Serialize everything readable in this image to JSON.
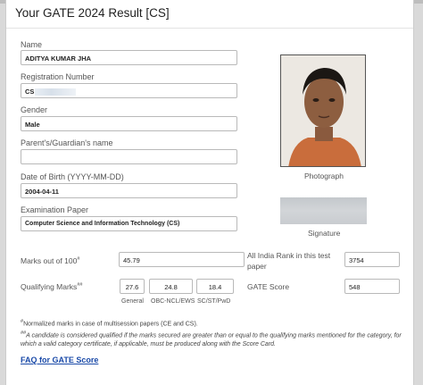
{
  "modal": {
    "title": "Your GATE 2024 Result [CS]"
  },
  "candidate": {
    "name_label": "Name",
    "name_value": "ADITYA KUMAR JHA",
    "registration_label": "Registration Number",
    "registration_value": "CS",
    "gender_label": "Gender",
    "gender_value": "Male",
    "parent_label": "Parent's/Guardian's name",
    "parent_value": "",
    "dob_label": "Date of Birth (YYYY-MM-DD)",
    "dob_value": "2004-04-11",
    "exam_paper_label": "Examination Paper",
    "exam_paper_value": "Computer Science and Information Technology (CS)"
  },
  "media": {
    "photo_caption": "Photograph",
    "signature_caption": "Signature",
    "photo_icon": "candidate-photo",
    "signature_icon": "signature-image"
  },
  "scores": {
    "marks_label": "Marks out of 100",
    "marks_label_sup": "#",
    "marks_value": "45.79",
    "air_label": "All India Rank in this test paper",
    "air_value": "3754",
    "qualifying_label": "Qualifying Marks",
    "qualifying_label_sup": "##",
    "qualifying": [
      {
        "value": "27.6",
        "category": "General"
      },
      {
        "value": "24.8",
        "category": "OBC-NCL/EWS"
      },
      {
        "value": "18.4",
        "category": "SC/ST/PwD"
      }
    ],
    "gate_score_label": "GATE Score",
    "gate_score_value": "548"
  },
  "notes": {
    "note1_sup": "#",
    "note1": "Normalized marks in case of multisession papers (CE and CS).",
    "note2_sup": "##",
    "note2": "A candidate is considered qualified if the marks secured are greater than or equal to the qualifying marks mentioned for the category, for which a valid category certificate, if applicable, must be produced along with the Score Card."
  },
  "links": {
    "faq": "FAQ for GATE Score"
  },
  "colors": {
    "link": "#1a4aa8",
    "border": "#b9b9b9",
    "background": "#d9d9d9"
  }
}
